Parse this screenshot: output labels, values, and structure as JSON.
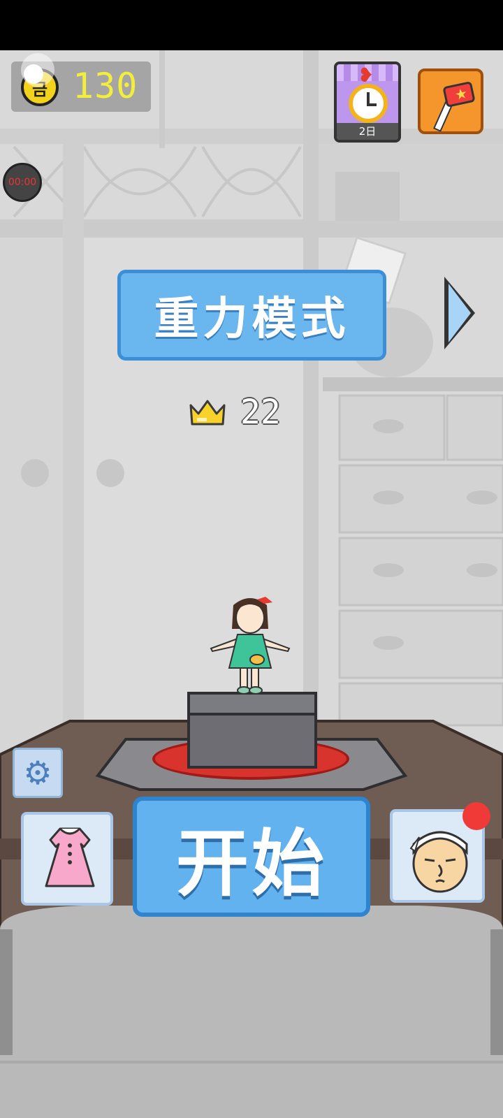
{
  "hud": {
    "coins": "130",
    "coin_symbol": "금",
    "recording_timer": "00:00"
  },
  "daily_reward": {
    "label": "2日"
  },
  "mode": {
    "title": "重力模式"
  },
  "best": {
    "score": "22"
  },
  "buttons": {
    "start_label": "开始"
  },
  "colors": {
    "coin_text": "#f3ee3c",
    "banner_blue": "#6ab6ef",
    "start_blue": "#62b2ef",
    "notification_red": "#ef3a37",
    "flag_orange": "#f5962d"
  },
  "icons": {
    "coin": "coin-icon",
    "settings": "gear-icon",
    "daily_reward": "alarm-clock-icon",
    "event_flag": "flag-icon",
    "next_mode": "chevron-right-icon",
    "best_score": "crown-icon",
    "outfit": "dress-icon",
    "character": "chef-character-icon"
  }
}
